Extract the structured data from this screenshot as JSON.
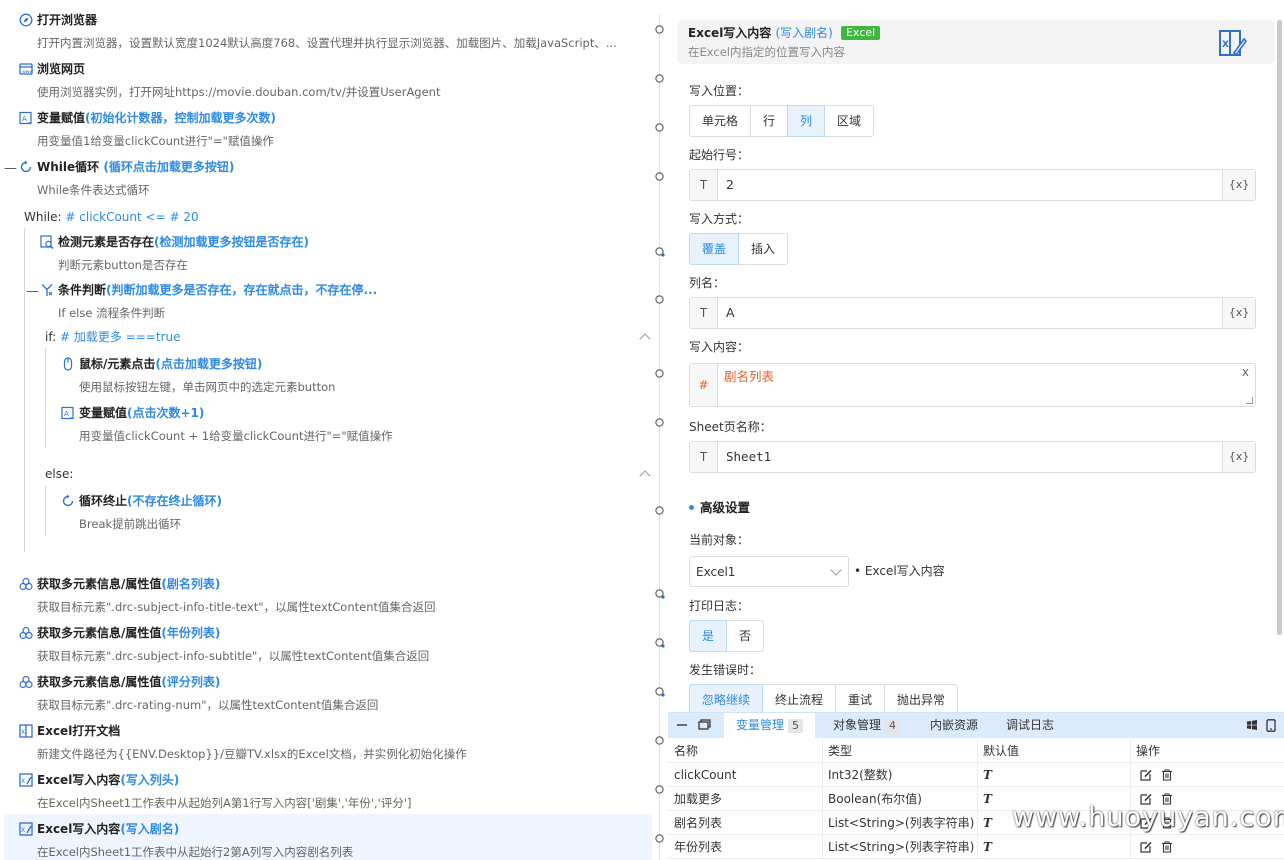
{
  "flow": {
    "steps": [
      {
        "title": "打开浏览器",
        "alias": "",
        "desc": "打开内置浏览器，设置默认宽度1024默认高度768、设置代理并执行显示浏览器、加载图片、加载JavaScript、..."
      },
      {
        "title": "浏览网页",
        "alias": "",
        "desc": "使用浏览器实例，打开网址https://movie.douban.com/tv/并设置UserAgent"
      },
      {
        "title": "变量赋值",
        "alias": "(初始化计数器，控制加载更多次数)",
        "desc": "用变量值1给变量clickCount进行\"=\"赋值操作"
      },
      {
        "title": "While循环",
        "alias": "(循环点击加载更多按钮)",
        "desc": "While条件表达式循环"
      },
      {
        "title": "检测元素是否存在",
        "alias": "(检测加载更多按钮是否存在)",
        "desc": "判断元素button是否存在"
      },
      {
        "title": "条件判断",
        "alias": "(判断加载更多是否存在，存在就点击，不存在停...",
        "desc": "If else 流程条件判断"
      },
      {
        "title": "鼠标/元素点击",
        "alias": "(点击加载更多按钮)",
        "desc": "使用鼠标按钮左键，单击网页中的选定元素button"
      },
      {
        "title": "变量赋值",
        "alias": "(点击次数+1)",
        "desc": "用变量值clickCount + 1给变量clickCount进行\"=\"赋值操作"
      },
      {
        "title": "循环终止",
        "alias": "(不存在终止循环)",
        "desc": "Break提前跳出循环"
      },
      {
        "title": "获取多元素信息/属性值",
        "alias": "(剧名列表)",
        "desc": "获取目标元素\".drc-subject-info-title-text\"，以属性textContent值集合返回"
      },
      {
        "title": "获取多元素信息/属性值",
        "alias": "(年份列表)",
        "desc": "获取目标元素\".drc-subject-info-subtitle\"，以属性textContent值集合返回"
      },
      {
        "title": "获取多元素信息/属性值",
        "alias": "(评分列表)",
        "desc": "获取目标元素\".drc-rating-num\"，以属性textContent值集合返回"
      },
      {
        "title": "Excel打开文档",
        "alias": "",
        "desc": "新建文件路径为{{ENV.Desktop}}/豆瓣TV.xlsx的Excel文档，并实例化初始化操作"
      },
      {
        "title": "Excel写入内容",
        "alias": "(写入列头)",
        "desc": "在Excel内Sheet1工作表中从起始列A第1行写入内容['剧集','年份','评分']"
      },
      {
        "title": "Excel写入内容",
        "alias": "(写入剧名)",
        "desc": "在Excel内Sheet1工作表中从起始行2第A列写入内容剧名列表"
      }
    ],
    "while_label": "While:",
    "while_expr": "# clickCount <= # 20",
    "if_label": "if:",
    "if_expr": "# 加载更多 ===true",
    "else_label": "else:",
    "minus": "—"
  },
  "panel": {
    "title": "Excel写入内容",
    "alias": "(写入剧名)",
    "badge": "Excel",
    "subtitle": "在Excel内指定的位置写入内容",
    "write_pos_label": "写入位置：",
    "write_pos_options": [
      "单元格",
      "行",
      "列",
      "区域"
    ],
    "write_pos_selected": 2,
    "start_row_label": "起始行号：",
    "start_row_value": "2",
    "write_mode_label": "写入方式：",
    "write_mode_options": [
      "覆盖",
      "插入"
    ],
    "write_mode_selected": 0,
    "column_label": "列名：",
    "column_value": "A",
    "content_label": "写入内容：",
    "content_value": "剧名列表",
    "content_prefix": "#",
    "clear_x": "x",
    "sheet_label": "Sheet页名称：",
    "sheet_value": "Sheet1",
    "type_prefix": "T",
    "var_btn": "{x}",
    "advanced_label": "高级设置",
    "current_obj_label": "当前对象：",
    "current_obj_value": "Excel1",
    "current_obj_note": "• Excel写入内容",
    "log_label": "打印日志：",
    "log_options": [
      "是",
      "否"
    ],
    "log_selected": 0,
    "error_label": "发生错误时：",
    "error_options": [
      "忽略继续",
      "终止流程",
      "重试",
      "抛出异常"
    ],
    "error_selected": 0
  },
  "bottom": {
    "tabs": [
      {
        "label": "变量管理",
        "count": "5"
      },
      {
        "label": "对象管理",
        "count": "4"
      },
      {
        "label": "内嵌资源",
        "count": ""
      },
      {
        "label": "调试日志",
        "count": ""
      }
    ],
    "active_tab": 0,
    "columns": [
      "名称",
      "类型",
      "默认值",
      "操作"
    ],
    "rows": [
      {
        "name": "clickCount",
        "type": "Int32(整数)",
        "default": "T"
      },
      {
        "name": "加载更多",
        "type": "Boolean(布尔值)",
        "default": "T"
      },
      {
        "name": "剧名列表",
        "type": "List<String>(列表字符串)",
        "default": "T"
      },
      {
        "name": "年份列表",
        "type": "List<String>(列表字符串)",
        "default": "T"
      }
    ]
  },
  "watermark": "www.huoyuyan.com",
  "colors": {
    "accent": "#2f8ae5",
    "excel_badge": "#3db83d",
    "content_var": "#e0632e"
  }
}
